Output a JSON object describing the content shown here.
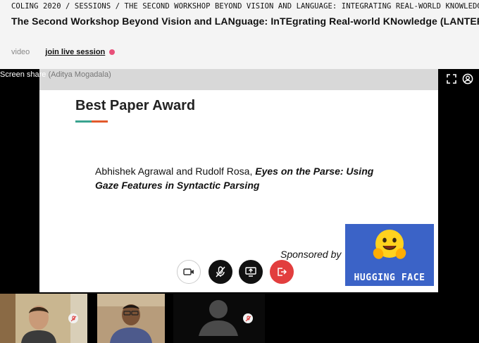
{
  "breadcrumb": {
    "conference": "COLING 2020",
    "separator": " / ",
    "sessions": "SESSIONS",
    "workshop": "THE SECOND WORKSHOP BEYOND VISION AND LANGUAGE: INTEGRATING REAL-WORLD KNOWLEDGE"
  },
  "page_title": "The Second Workshop Beyond Vision and LANguage: InTEgrating Real-world KNowledge (LANTERN )",
  "tabs": {
    "video": "video",
    "live": "join live session"
  },
  "screen_share": {
    "label": "Screen share",
    "presenter": "(Aditya Mogadala)"
  },
  "slide": {
    "title": "Best Paper Award",
    "authors": "Abhishek Agrawal and Rudolf Rosa, ",
    "paper_title": "Eyes on the Parse: Using Gaze Features in Syntactic Parsing",
    "sponsored_by": "Sponsored by",
    "sponsor_name": "HUGGING FACE"
  },
  "icons": {
    "fullscreen": "fullscreen-icon",
    "account": "account-icon",
    "camera": "camera-icon",
    "mic_muted": "mic-muted-icon",
    "share_screen": "share-screen-icon",
    "leave": "leave-icon"
  },
  "colors": {
    "live_dot": "#e8507a",
    "leave": "#e23e3e",
    "sponsor_bg": "#3b63c7",
    "underline_left": "#3aa38f",
    "underline_right": "#e25a2c"
  }
}
